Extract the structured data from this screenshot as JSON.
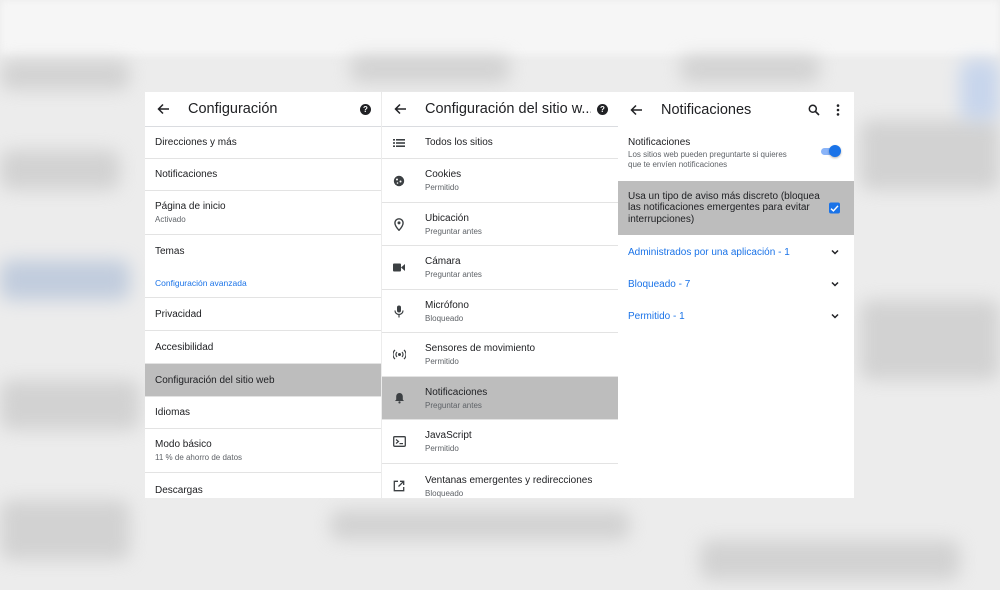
{
  "panel1": {
    "title": "Configuración",
    "items": [
      {
        "title": "Direcciones y más"
      },
      {
        "title": "Notificaciones"
      },
      {
        "title": "Página de inicio",
        "subtitle": "Activado"
      },
      {
        "title": "Temas"
      },
      {
        "title": "Configuración avanzada"
      },
      {
        "title": "Privacidad"
      },
      {
        "title": "Accesibilidad"
      },
      {
        "title": "Configuración del sitio web"
      },
      {
        "title": "Idiomas"
      },
      {
        "title": "Modo básico",
        "subtitle": "11 % de ahorro de datos"
      },
      {
        "title": "Descargas"
      }
    ]
  },
  "panel2": {
    "title": "Configuración del sitio w...",
    "items": [
      {
        "title": "Todos los sitios",
        "icon": "list-icon"
      },
      {
        "title": "Cookies",
        "subtitle": "Permitido",
        "icon": "cookie-icon"
      },
      {
        "title": "Ubicación",
        "subtitle": "Preguntar antes",
        "icon": "location-pin-icon"
      },
      {
        "title": "Cámara",
        "subtitle": "Preguntar antes",
        "icon": "camera-icon"
      },
      {
        "title": "Micrófono",
        "subtitle": "Bloqueado",
        "icon": "microphone-icon"
      },
      {
        "title": "Sensores de movimiento",
        "subtitle": "Permitido",
        "icon": "sensors-icon"
      },
      {
        "title": "Notificaciones",
        "subtitle": "Preguntar antes",
        "icon": "bell-icon"
      },
      {
        "title": "JavaScript",
        "subtitle": "Permitido",
        "icon": "javascript-icon"
      },
      {
        "title": "Ventanas emergentes y redirecciones",
        "subtitle": "Bloqueado",
        "icon": "open-external-icon"
      }
    ]
  },
  "panel3": {
    "title": "Notificaciones",
    "main_toggle": {
      "title": "Notificaciones",
      "subtitle_line1": "Los sitios web pueden preguntarte si quieres",
      "subtitle_line2": "que te envíen notificaciones",
      "enabled": true
    },
    "discreet_option": {
      "line1": "Usa un tipo de aviso más discreto (bloquea",
      "line2": "las notificaciones emergentes para evitar",
      "line3": "interrupciones)",
      "checked": true
    },
    "groups": [
      {
        "label": "Administrados por una aplicación - 1"
      },
      {
        "label": "Bloqueado - 7"
      },
      {
        "label": "Permitido - 1"
      }
    ]
  },
  "colors": {
    "accent": "#1a73e8",
    "selected_row": "#bdbdbd",
    "divider": "#e3e3e3"
  }
}
